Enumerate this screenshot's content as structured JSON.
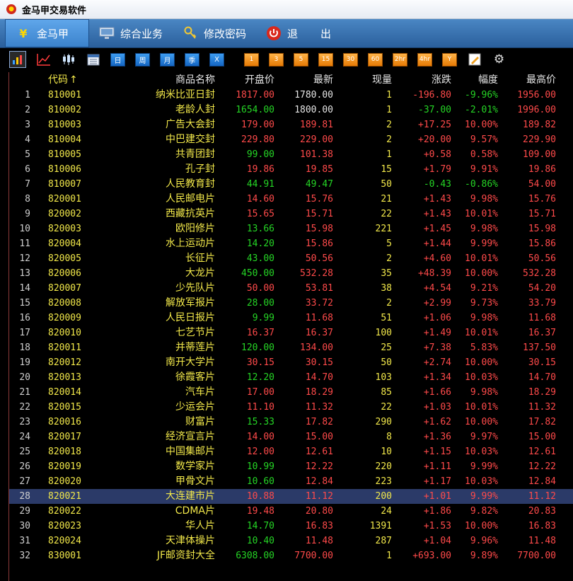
{
  "window": {
    "title": "金马甲交易软件"
  },
  "menu": [
    {
      "label": "金马甲",
      "icon": "yen-icon"
    },
    {
      "label": "综合业务",
      "icon": "monitor-icon"
    },
    {
      "label": "修改密码",
      "icon": "key-icon"
    },
    {
      "label": "退",
      "icon": "power-icon"
    },
    {
      "label": "出",
      "icon": ""
    }
  ],
  "toolbar": {
    "icons": [
      "bar-chart-icon",
      "line-chart-icon",
      "candlestick-icon",
      "calendar-icon"
    ],
    "period_buttons": [
      "日",
      "周",
      "月",
      "季",
      "X"
    ],
    "minute_buttons": [
      "1",
      "3",
      "5",
      "15",
      "30",
      "60",
      "2hr",
      "4hr",
      "Y"
    ],
    "tool_icons": [
      "edit-icon",
      "gear-icon"
    ]
  },
  "table": {
    "columns": [
      "代码",
      "商品名称",
      "开盘价",
      "最新",
      "现量",
      "涨跌",
      "幅度",
      "最高价"
    ],
    "sort_arrow": "↑",
    "colors": {
      "up": "#ff4a4a",
      "down": "#25d525",
      "flat": "#e6e6e6"
    },
    "rows": [
      [
        "1",
        "810001",
        "纳米比亚日封",
        "1817.00",
        "1780.00",
        "1",
        "-196.80",
        "-9.96%",
        "1956.00"
      ],
      [
        "2",
        "810002",
        "老龄人封",
        "1654.00",
        "1800.00",
        "1",
        "-37.00",
        "-2.01%",
        "1996.00"
      ],
      [
        "3",
        "810003",
        "广告大会封",
        "179.00",
        "189.81",
        "2",
        "+17.25",
        "10.00%",
        "189.82"
      ],
      [
        "4",
        "810004",
        "中巴建交封",
        "229.80",
        "229.00",
        "2",
        "+20.00",
        "9.57%",
        "229.90"
      ],
      [
        "5",
        "810005",
        "共青团封",
        "99.00",
        "101.38",
        "1",
        "+0.58",
        "0.58%",
        "109.00"
      ],
      [
        "6",
        "810006",
        "孔子封",
        "19.86",
        "19.85",
        "15",
        "+1.79",
        "9.91%",
        "19.86"
      ],
      [
        "7",
        "810007",
        "人民教育封",
        "44.91",
        "49.47",
        "50",
        "-0.43",
        "-0.86%",
        "54.00"
      ],
      [
        "8",
        "820001",
        "人民邮电片",
        "14.60",
        "15.76",
        "21",
        "+1.43",
        "9.98%",
        "15.76"
      ],
      [
        "9",
        "820002",
        "西藏抗英片",
        "15.65",
        "15.71",
        "22",
        "+1.43",
        "10.01%",
        "15.71"
      ],
      [
        "10",
        "820003",
        "欧阳修片",
        "13.66",
        "15.98",
        "221",
        "+1.45",
        "9.98%",
        "15.98"
      ],
      [
        "11",
        "820004",
        "水上运动片",
        "14.20",
        "15.86",
        "5",
        "+1.44",
        "9.99%",
        "15.86"
      ],
      [
        "12",
        "820005",
        "长征片",
        "43.00",
        "50.56",
        "2",
        "+4.60",
        "10.01%",
        "50.56"
      ],
      [
        "13",
        "820006",
        "大龙片",
        "450.00",
        "532.28",
        "35",
        "+48.39",
        "10.00%",
        "532.28"
      ],
      [
        "14",
        "820007",
        "少先队片",
        "50.00",
        "53.81",
        "38",
        "+4.54",
        "9.21%",
        "54.20"
      ],
      [
        "15",
        "820008",
        "解放军报片",
        "28.00",
        "33.72",
        "2",
        "+2.99",
        "9.73%",
        "33.79"
      ],
      [
        "16",
        "820009",
        "人民日报片",
        "9.99",
        "11.68",
        "51",
        "+1.06",
        "9.98%",
        "11.68"
      ],
      [
        "17",
        "820010",
        "七艺节片",
        "16.37",
        "16.37",
        "100",
        "+1.49",
        "10.01%",
        "16.37"
      ],
      [
        "18",
        "820011",
        "并蒂莲片",
        "120.00",
        "134.00",
        "25",
        "+7.38",
        "5.83%",
        "137.50"
      ],
      [
        "19",
        "820012",
        "南开大学片",
        "30.15",
        "30.15",
        "50",
        "+2.74",
        "10.00%",
        "30.15"
      ],
      [
        "20",
        "820013",
        "徐霞客片",
        "12.20",
        "14.70",
        "103",
        "+1.34",
        "10.03%",
        "14.70"
      ],
      [
        "21",
        "820014",
        "汽车片",
        "17.00",
        "18.29",
        "85",
        "+1.66",
        "9.98%",
        "18.29"
      ],
      [
        "22",
        "820015",
        "少运会片",
        "11.10",
        "11.32",
        "22",
        "+1.03",
        "10.01%",
        "11.32"
      ],
      [
        "23",
        "820016",
        "财富片",
        "15.33",
        "17.82",
        "290",
        "+1.62",
        "10.00%",
        "17.82"
      ],
      [
        "24",
        "820017",
        "经济宣言片",
        "14.00",
        "15.00",
        "8",
        "+1.36",
        "9.97%",
        "15.00"
      ],
      [
        "25",
        "820018",
        "中国集邮片",
        "12.00",
        "12.61",
        "10",
        "+1.15",
        "10.03%",
        "12.61"
      ],
      [
        "26",
        "820019",
        "数学家片",
        "10.99",
        "12.22",
        "220",
        "+1.11",
        "9.99%",
        "12.22"
      ],
      [
        "27",
        "820020",
        "甲骨文片",
        "10.60",
        "12.84",
        "223",
        "+1.17",
        "10.03%",
        "12.84"
      ],
      [
        "28",
        "820021",
        "大连建市片",
        "10.88",
        "11.12",
        "200",
        "+1.01",
        "9.99%",
        "11.12"
      ],
      [
        "29",
        "820022",
        "CDMA片",
        "19.48",
        "20.80",
        "24",
        "+1.86",
        "9.82%",
        "20.83"
      ],
      [
        "30",
        "820023",
        "华人片",
        "14.70",
        "16.83",
        "1391",
        "+1.53",
        "10.00%",
        "16.83"
      ],
      [
        "31",
        "820024",
        "天津体操片",
        "10.40",
        "11.48",
        "287",
        "+1.04",
        "9.96%",
        "11.48"
      ],
      [
        "32",
        "830001",
        "JF邮资封大全",
        "6308.00",
        "7700.00",
        "1",
        "+693.00",
        "9.89%",
        "7700.00"
      ]
    ],
    "row_styles": [
      [
        "red",
        "white",
        "red",
        "green",
        "red"
      ],
      [
        "green",
        "white",
        "green",
        "green",
        "red"
      ],
      [
        "red",
        "red",
        "red",
        "red",
        "red"
      ],
      [
        "red",
        "red",
        "red",
        "red",
        "red"
      ],
      [
        "green",
        "red",
        "red",
        "red",
        "red"
      ],
      [
        "red",
        "red",
        "red",
        "red",
        "red"
      ],
      [
        "green",
        "green",
        "green",
        "green",
        "red"
      ],
      [
        "red",
        "red",
        "red",
        "red",
        "red"
      ],
      [
        "red",
        "red",
        "red",
        "red",
        "red"
      ],
      [
        "green",
        "red",
        "red",
        "red",
        "red"
      ],
      [
        "green",
        "red",
        "red",
        "red",
        "red"
      ],
      [
        "green",
        "red",
        "red",
        "red",
        "red"
      ],
      [
        "green",
        "red",
        "red",
        "red",
        "red"
      ],
      [
        "red",
        "red",
        "red",
        "red",
        "red"
      ],
      [
        "green",
        "red",
        "red",
        "red",
        "red"
      ],
      [
        "green",
        "red",
        "red",
        "red",
        "red"
      ],
      [
        "red",
        "red",
        "red",
        "red",
        "red"
      ],
      [
        "green",
        "red",
        "red",
        "red",
        "red"
      ],
      [
        "red",
        "red",
        "red",
        "red",
        "red"
      ],
      [
        "green",
        "red",
        "red",
        "red",
        "red"
      ],
      [
        "red",
        "red",
        "red",
        "red",
        "red"
      ],
      [
        "red",
        "red",
        "red",
        "red",
        "red"
      ],
      [
        "green",
        "red",
        "red",
        "red",
        "red"
      ],
      [
        "red",
        "red",
        "red",
        "red",
        "red"
      ],
      [
        "red",
        "red",
        "red",
        "red",
        "red"
      ],
      [
        "green",
        "red",
        "red",
        "red",
        "red"
      ],
      [
        "green",
        "red",
        "red",
        "red",
        "red"
      ],
      [
        "red",
        "red",
        "red",
        "red",
        "red"
      ],
      [
        "red",
        "red",
        "red",
        "red",
        "red"
      ],
      [
        "green",
        "red",
        "red",
        "red",
        "red"
      ],
      [
        "green",
        "red",
        "red",
        "red",
        "red"
      ],
      [
        "green",
        "red",
        "red",
        "red",
        "red"
      ]
    ],
    "selected_row": 28
  }
}
